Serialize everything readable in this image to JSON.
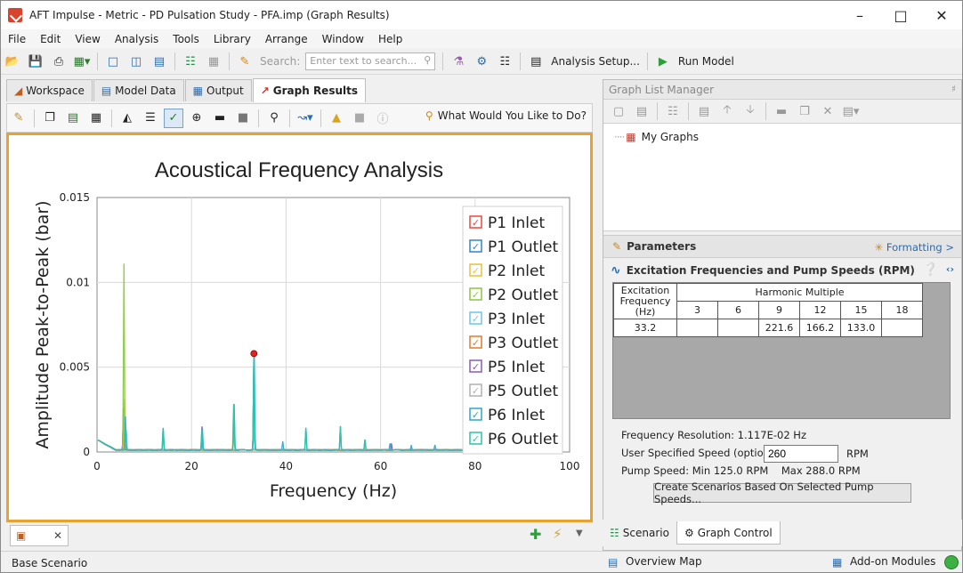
{
  "window": {
    "title": "AFT Impulse - Metric - PD Pulsation Study - PFA.imp (Graph Results)"
  },
  "menu": [
    "File",
    "Edit",
    "View",
    "Analysis",
    "Tools",
    "Library",
    "Arrange",
    "Window",
    "Help"
  ],
  "toolbar": {
    "search_label": "Search:",
    "search_placeholder": "Enter text to search...",
    "analysis_setup": "Analysis Setup...",
    "run_model": "Run Model"
  },
  "tabs": [
    "Workspace",
    "Model Data",
    "Output",
    "Graph Results"
  ],
  "graph_toolbar": {
    "wwyl": "What Would You Like to Do?"
  },
  "chart_data": {
    "type": "line",
    "title": "Acoustical Frequency Analysis",
    "xlabel": "Frequency (Hz)",
    "ylabel": "Amplitude Peak-to-Peak (bar)",
    "xlim": [
      0,
      100
    ],
    "ylim": [
      0,
      0.015
    ],
    "xticks": [
      "0",
      "20",
      "40",
      "60",
      "80",
      "100"
    ],
    "yticks": [
      "0",
      "0.005",
      "0.01",
      "0.015"
    ],
    "grid": true,
    "legend_position": "right",
    "series": [
      {
        "name": "P1 Inlet",
        "color": "#e8493a",
        "peaks": [
          [
            5.6,
            0.002
          ],
          [
            33.2,
            0.0055
          ]
        ]
      },
      {
        "name": "P1 Outlet",
        "color": "#2f86c7",
        "peaks": [
          [
            5.6,
            0.0025
          ],
          [
            33.2,
            0.0058
          ]
        ]
      },
      {
        "name": "P2 Inlet",
        "color": "#e8c03a",
        "peaks": [
          [
            5.8,
            0.003
          ],
          [
            14.0,
            0.0012
          ]
        ]
      },
      {
        "name": "P2 Outlet",
        "color": "#8cc63f",
        "peaks": [
          [
            5.7,
            0.011
          ],
          [
            28.9,
            0.0027
          ]
        ]
      },
      {
        "name": "P3 Inlet",
        "color": "#6ec6ec",
        "peaks": [
          [
            6.2,
            0.0012
          ],
          [
            33.3,
            0.0055
          ]
        ]
      },
      {
        "name": "P3 Outlet",
        "color": "#e07a2e",
        "peaks": [
          [
            6.0,
            0.001
          ]
        ]
      },
      {
        "name": "P5 Inlet",
        "color": "#8e58b5",
        "peaks": [
          [
            22.2,
            0.0014
          ],
          [
            62.3,
            0.0004
          ],
          [
            79.0,
            0.0004
          ]
        ]
      },
      {
        "name": "P5 Outlet",
        "color": "#b0b0b0",
        "peaks": [
          [
            6.1,
            0.0008
          ]
        ]
      },
      {
        "name": "P6 Inlet",
        "color": "#2aa7cf",
        "peaks": [
          [
            6.0,
            0.002
          ],
          [
            14.0,
            0.0013
          ],
          [
            22.3,
            0.0013
          ],
          [
            29.0,
            0.0027
          ],
          [
            33.2,
            0.0058
          ],
          [
            39.3,
            0.0005
          ],
          [
            44.2,
            0.0013
          ],
          [
            51.5,
            0.0014
          ],
          [
            56.7,
            0.0006
          ],
          [
            62.0,
            0.0004
          ],
          [
            66.5,
            0.0003
          ],
          [
            71.5,
            0.0003
          ],
          [
            80.0,
            0.0003
          ]
        ]
      },
      {
        "name": "P6 Outlet",
        "color": "#2ec4a5",
        "peaks": [
          [
            6.0,
            0.0015
          ],
          [
            14.0,
            0.0013
          ],
          [
            22.2,
            0.0012
          ],
          [
            29.0,
            0.0027
          ],
          [
            33.2,
            0.0058
          ],
          [
            44.2,
            0.0013
          ],
          [
            51.5,
            0.0014
          ],
          [
            56.7,
            0.0006
          ]
        ]
      }
    ],
    "marker_point": {
      "x": 33.2,
      "y": 0.0058
    }
  },
  "glm": {
    "title": "Graph List Manager",
    "tree_item": "My Graphs"
  },
  "params": {
    "title": "Parameters",
    "formatting": "Formatting >",
    "section": "Excitation Frequencies and Pump Speeds (RPM)"
  },
  "harmonic_table": {
    "col0": [
      "Excitation",
      "Frequency",
      "(Hz)"
    ],
    "group": "Harmonic Multiple",
    "headers": [
      "3",
      "6",
      "9",
      "12",
      "15",
      "18"
    ],
    "row": [
      "33.2",
      "",
      "",
      "221.6",
      "166.2",
      "133.0",
      ""
    ]
  },
  "info": {
    "resolution": "Frequency Resolution: 1.117E-02 Hz",
    "user_speed_label": "User Specified Speed (optional):",
    "user_speed_value": "260",
    "rpm": "RPM",
    "pump_speed": "Pump Speed: Min 125.0 RPM    Max 288.0 RPM",
    "create_btn": "Create Scenarios Based On Selected Pump Speeds..."
  },
  "right_tabs": [
    "Scenario",
    "Graph Control"
  ],
  "status": {
    "scenario": "Base Scenario",
    "overview": "Overview Map",
    "addon": "Add-on Modules"
  }
}
